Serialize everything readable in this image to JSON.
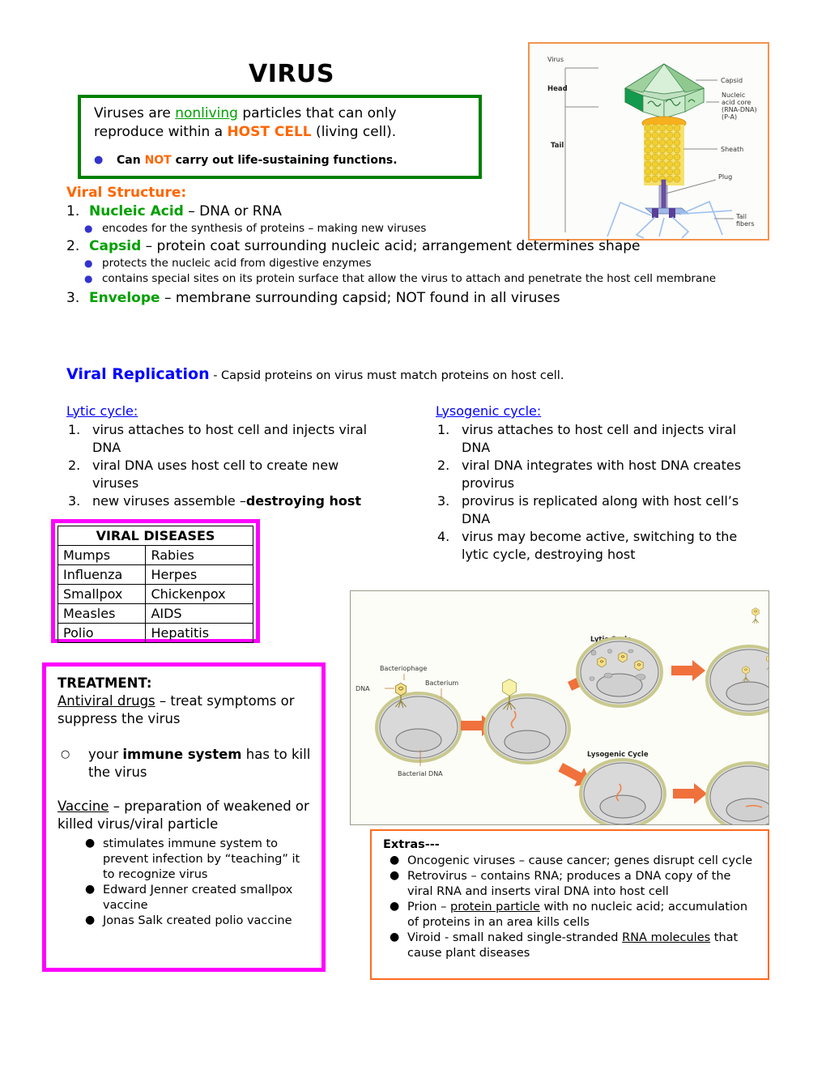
{
  "title": "VIRUS",
  "definition_box": {
    "line1_pre": "Viruses are ",
    "line1_hl": "nonliving",
    "line1_mid": " particles that can only reproduce within a ",
    "line1_hl2": "HOST CELL",
    "line1_post": " (living cell).",
    "bullet_pre": "Can ",
    "bullet_hl": "NOT",
    "bullet_post": " carry out life-sustaining functions."
  },
  "viral_structure": {
    "heading": "Viral Structure:",
    "items": [
      {
        "num": "1.",
        "term": "Nucleic Acid",
        "desc": " – DNA or RNA",
        "subs": [
          "encodes for the synthesis of proteins – making new viruses"
        ]
      },
      {
        "num": "2.",
        "term": "Capsid",
        "desc": " – protein coat surrounding nucleic acid; arrangement determines shape",
        "subs": [
          "protects the nucleic acid from digestive enzymes",
          "contains special sites on its protein surface that allow the virus to attach and penetrate the host cell membrane"
        ]
      },
      {
        "num": "3.",
        "term": "Envelope",
        "desc": " – membrane surrounding capsid; NOT found in all viruses",
        "subs": []
      }
    ]
  },
  "virus_diagram": {
    "labels": {
      "virus": "Virus",
      "head": "Head",
      "tail": "Tail",
      "capsid": "Capsid",
      "nucleic_core_1": "Nucleic",
      "nucleic_core_2": "acid core",
      "nucleic_core_3": "(RNA-DNA)",
      "nucleic_core_4": "(P-A)",
      "sheath": "Sheath",
      "plug": "Plug",
      "tail_fibers_1": "Tail",
      "tail_fibers_2": "fibers"
    }
  },
  "viral_replication": {
    "title": "Viral Replication",
    "subtitle": " - Capsid proteins on virus must match proteins on host cell."
  },
  "lytic_cycle": {
    "heading": "Lytic cycle:",
    "steps": [
      {
        "num": "1.",
        "text": "virus attaches to host cell and injects viral DNA"
      },
      {
        "num": "2.",
        "text": "viral DNA uses host cell to create new viruses"
      },
      {
        "num": "3.",
        "text_pre": "new viruses assemble –",
        "text_bold": "destroying host"
      }
    ]
  },
  "lysogenic_cycle": {
    "heading": "Lysogenic cycle:",
    "steps": [
      {
        "num": "1.",
        "text": "virus attaches to host cell and injects viral DNA"
      },
      {
        "num": "2.",
        "text": "viral DNA integrates with host DNA creates provirus"
      },
      {
        "num": "3.",
        "text": "provirus is replicated along with host cell’s DNA"
      },
      {
        "num": "4.",
        "text": "virus may become active, switching to the lytic cycle, destroying host"
      }
    ]
  },
  "viral_diseases": {
    "header": "VIRAL DISEASES",
    "rows": [
      [
        "Mumps",
        "Rabies"
      ],
      [
        "Influenza",
        "Herpes"
      ],
      [
        "Smallpox",
        "Chickenpox"
      ],
      [
        "Measles",
        "AIDS"
      ],
      [
        "Polio",
        "Hepatitis"
      ]
    ]
  },
  "treatment": {
    "heading": "TREATMENT:",
    "antiviral_term": "Antiviral drugs",
    "antiviral_desc": " – treat symptoms or suppress the virus",
    "immune_pre": "your ",
    "immune_bold": "immune system",
    "immune_post": " has to kill the virus",
    "vaccine_term": "Vaccine",
    "vaccine_desc": " – preparation of weakened or killed virus/viral particle",
    "bullets": [
      "stimulates immune system to prevent infection by “teaching” it to recognize virus",
      "Edward Jenner created smallpox vaccine",
      "Jonas Salk created polio vaccine"
    ]
  },
  "cycle_diagram": {
    "labels": {
      "bacteriophage": "Bacteriophage",
      "dna": "DNA",
      "bacterium": "Bacterium",
      "bacterial_dna": "Bacterial DNA",
      "lytic_cycle": "Lytic Cycle",
      "lysogenic_cycle": "Lysogenic Cycle"
    }
  },
  "extras": {
    "heading": "Extras---",
    "items": [
      {
        "pre": "Oncogenic viruses – cause cancer; genes disrupt cell cycle",
        "u": "",
        "post": ""
      },
      {
        "pre": "Retrovirus – contains RNA; produces a DNA copy of the viral RNA and inserts viral DNA into host cell",
        "u": "",
        "post": ""
      },
      {
        "pre": "Prion – ",
        "u": "protein particle",
        "post": " with no nucleic acid; accumulation of proteins in an area kills cells"
      },
      {
        "pre": "Viroid - small naked single-stranded ",
        "u": "RNA molecules",
        "post": " that cause plant diseases"
      }
    ]
  },
  "colors": {
    "orange": "#ff6600",
    "green": "#008000",
    "green_text": "#00a000",
    "blue": "#0000ff",
    "magenta": "#ff00ff",
    "diagram_border_orange": "#f2944c",
    "arrow_orange": "#f4723a"
  }
}
